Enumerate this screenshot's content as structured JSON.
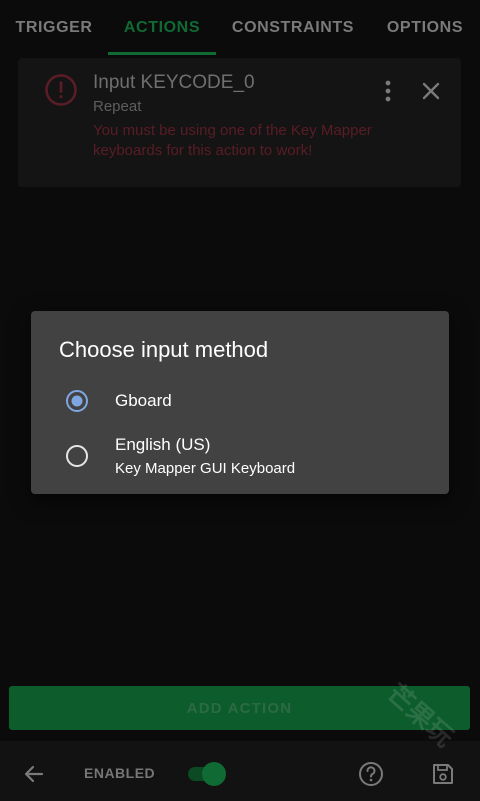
{
  "tabs": [
    {
      "label": "TRIGGER"
    },
    {
      "label": "ACTIONS",
      "active": true
    },
    {
      "label": "CONSTRAINTS"
    },
    {
      "label": "OPTIONS"
    }
  ],
  "action_card": {
    "title": "Input KEYCODE_0",
    "subtitle": "Repeat",
    "error_text": "You must be using one of the Key Mapper keyboards for this action to work!"
  },
  "dialog": {
    "title": "Choose input method",
    "options": [
      {
        "label": "Gboard",
        "selected": true
      },
      {
        "label": "English (US)",
        "sublabel": "Key Mapper GUI Keyboard",
        "selected": false
      }
    ]
  },
  "add_action_label": "ADD ACTION",
  "bottom_bar": {
    "enabled_label": "ENABLED",
    "enabled": true
  },
  "watermark": "芒果玩",
  "colors": {
    "accent_green": "#0f6b33",
    "error_red": "#5a1c26",
    "radio_selected": "#7fa6e0",
    "dialog_bg": "#424242"
  },
  "icons": [
    "error-icon",
    "more-vert-icon",
    "close-icon",
    "back-arrow-icon",
    "help-icon",
    "save-icon"
  ]
}
